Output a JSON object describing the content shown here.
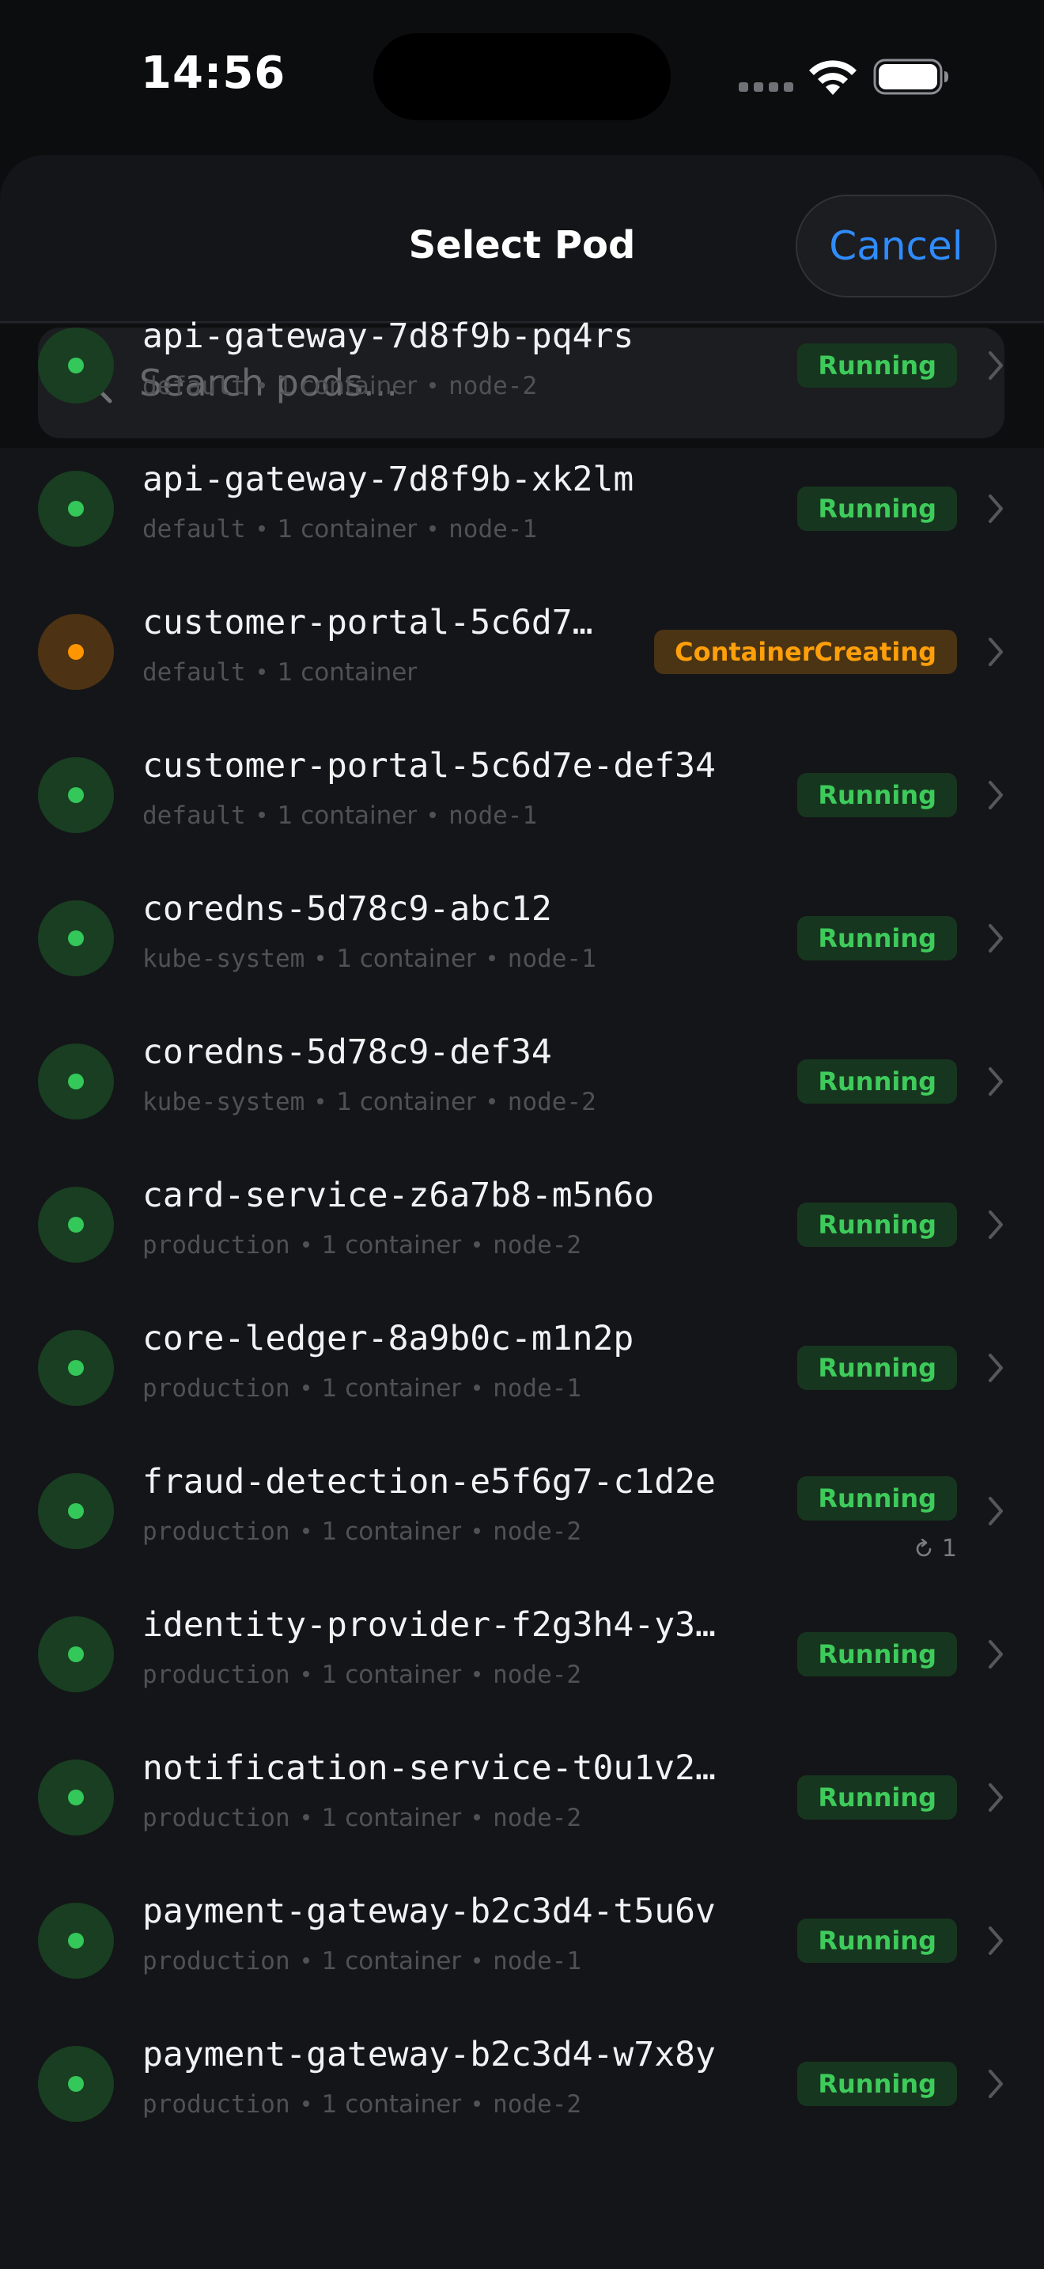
{
  "status_bar": {
    "time": "14:56"
  },
  "sheet": {
    "title": "Select Pod",
    "cancel_label": "Cancel",
    "search_placeholder": "Search pods..."
  },
  "colors": {
    "running_text": "#3ecb5b",
    "running_bg": "#17361f",
    "running_dot": "#34c759",
    "running_dot_bg": "#193e22",
    "creating_text": "#ff9f0a",
    "creating_bg": "#4a3414",
    "creating_dot": "#ff9500",
    "creating_dot_bg": "#4d3313",
    "accent": "#2f8cff"
  },
  "pods": [
    {
      "name": "api-gateway-7d8f9b-pq4rs",
      "namespace": "default",
      "containers": "1 container",
      "node": "node-2",
      "status": "Running",
      "state": "running"
    },
    {
      "name": "api-gateway-7d8f9b-xk2lm",
      "namespace": "default",
      "containers": "1 container",
      "node": "node-1",
      "status": "Running",
      "state": "running"
    },
    {
      "name": "customer-portal-5c6d7…",
      "namespace": "default",
      "containers": "1 container",
      "node": "",
      "status": "ContainerCreating",
      "state": "creating"
    },
    {
      "name": "customer-portal-5c6d7e-def34",
      "namespace": "default",
      "containers": "1 container",
      "node": "node-1",
      "status": "Running",
      "state": "running"
    },
    {
      "name": "coredns-5d78c9-abc12",
      "namespace": "kube-system",
      "containers": "1 container",
      "node": "node-1",
      "status": "Running",
      "state": "running"
    },
    {
      "name": "coredns-5d78c9-def34",
      "namespace": "kube-system",
      "containers": "1 container",
      "node": "node-2",
      "status": "Running",
      "state": "running"
    },
    {
      "name": "card-service-z6a7b8-m5n6o",
      "namespace": "production",
      "containers": "1 container",
      "node": "node-2",
      "status": "Running",
      "state": "running"
    },
    {
      "name": "core-ledger-8a9b0c-m1n2p",
      "namespace": "production",
      "containers": "1 container",
      "node": "node-1",
      "status": "Running",
      "state": "running"
    },
    {
      "name": "fraud-detection-e5f6g7-c1d2e",
      "namespace": "production",
      "containers": "1 container",
      "node": "node-2",
      "status": "Running",
      "state": "running",
      "restarts": "1"
    },
    {
      "name": "identity-provider-f2g3h4-y3…",
      "namespace": "production",
      "containers": "1 container",
      "node": "node-2",
      "status": "Running",
      "state": "running"
    },
    {
      "name": "notification-service-t0u1v2…",
      "namespace": "production",
      "containers": "1 container",
      "node": "node-2",
      "status": "Running",
      "state": "running"
    },
    {
      "name": "payment-gateway-b2c3d4-t5u6v",
      "namespace": "production",
      "containers": "1 container",
      "node": "node-1",
      "status": "Running",
      "state": "running"
    },
    {
      "name": "payment-gateway-b2c3d4-w7x8y",
      "namespace": "production",
      "containers": "1 container",
      "node": "node-2",
      "status": "Running",
      "state": "running"
    }
  ]
}
